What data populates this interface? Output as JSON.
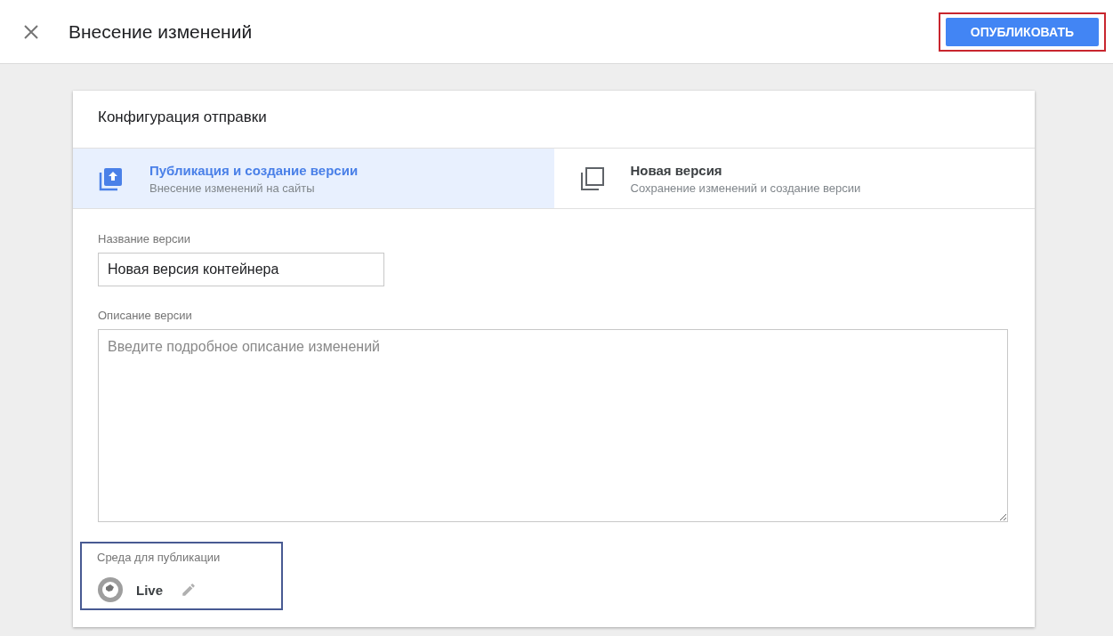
{
  "header": {
    "title": "Внесение изменений",
    "publish_button": "ОПУБЛИКОВАТЬ",
    "publish_highlighted": true
  },
  "card": {
    "title": "Конфигурация отправки",
    "options": [
      {
        "kind": "publish",
        "title": "Публикация и создание версии",
        "subtitle": "Внесение изменений на сайты",
        "selected": true
      },
      {
        "kind": "version",
        "title": "Новая версия",
        "subtitle": "Сохранение изменений и создание версии",
        "selected": false
      }
    ],
    "version_name": {
      "label": "Название версии",
      "value": "Новая версия контейнера"
    },
    "version_description": {
      "label": "Описание версии",
      "placeholder": "Введите подробное описание изменений"
    },
    "environment": {
      "label": "Среда для публикации",
      "name": "Live",
      "highlighted": true
    }
  }
}
